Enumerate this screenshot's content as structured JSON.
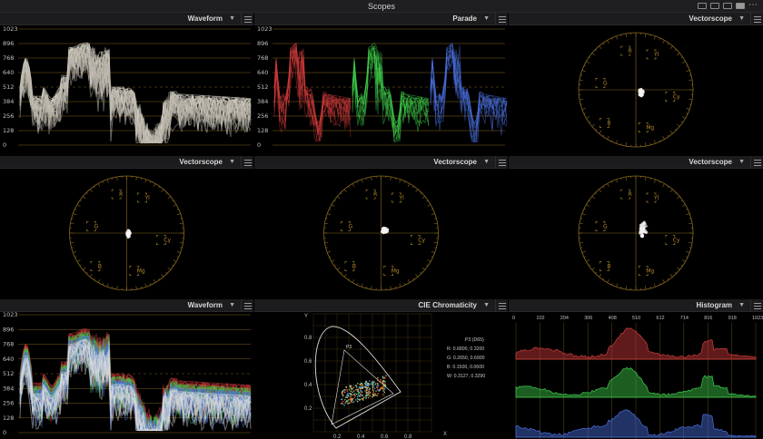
{
  "window": {
    "title": "Scopes",
    "menu": "⋯"
  },
  "panels": {
    "waveform_top": {
      "name": "Waveform"
    },
    "parade": {
      "name": "Parade"
    },
    "vs1": {
      "name": "Vectorscope"
    },
    "vs2": {
      "name": "Vectorscope"
    },
    "vs3": {
      "name": "Vectorscope"
    },
    "vs4": {
      "name": "Vectorscope"
    },
    "waveform_bottom": {
      "name": "Waveform"
    },
    "cie": {
      "name": "CIE Chromaticity"
    },
    "histogram": {
      "name": "Histogram"
    }
  },
  "scale": {
    "ticks": [
      "1023",
      "896",
      "768",
      "640",
      "512",
      "384",
      "256",
      "128",
      "0"
    ]
  },
  "vectorscope_targets": [
    "R",
    "Yl",
    "G",
    "Cy",
    "B",
    "Mg"
  ],
  "cie": {
    "y_axis": "Y",
    "x_axis": "X",
    "x_ticks": [
      "0.2",
      "0.4",
      "0.6",
      "0.8"
    ],
    "y_ticks": [
      "0.8",
      "0.6",
      "0.4",
      "0.2"
    ],
    "gamut": "P3",
    "info": [
      "P3 (D65)",
      "R: 0.6800, 0.3200",
      "G: 0.2650, 0.6900",
      "B: 0.1500, 0.0600",
      "W: 0.3127, 0.3290"
    ]
  },
  "histogram": {
    "ticks": [
      "0",
      "102",
      "204",
      "306",
      "408",
      "510",
      "612",
      "714",
      "816",
      "918",
      "1023"
    ]
  },
  "colors": {
    "grid": "#8a6a1e",
    "red": "#d33c3c",
    "green": "#3fcf4b",
    "blue": "#4a6fe0"
  }
}
